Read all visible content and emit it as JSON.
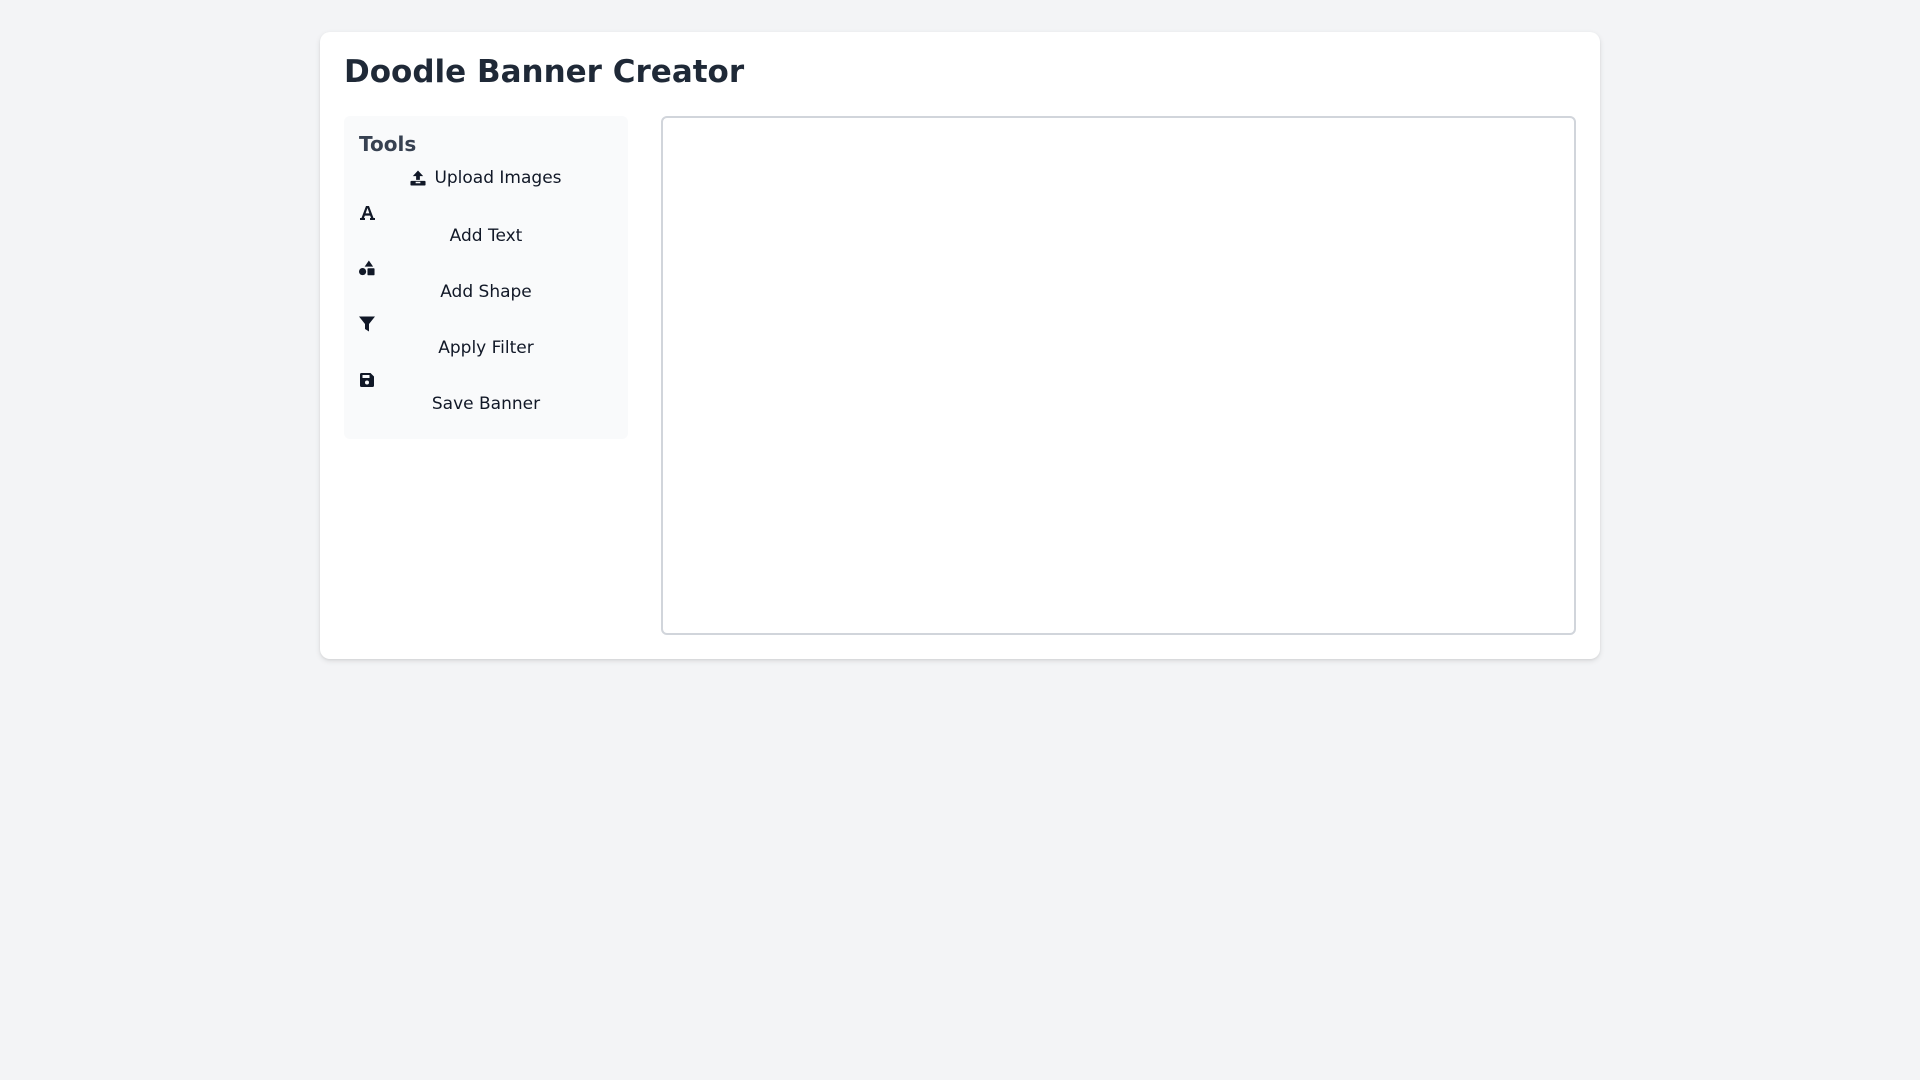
{
  "app": {
    "title": "Doodle Banner Creator"
  },
  "tools": {
    "heading": "Tools",
    "items": [
      {
        "label": "Upload Images",
        "icon": "upload-icon"
      },
      {
        "label": "Add Text",
        "icon": "font-icon"
      },
      {
        "label": "Add Shape",
        "icon": "shapes-icon"
      },
      {
        "label": "Apply Filter",
        "icon": "filter-icon"
      },
      {
        "label": "Save Banner",
        "icon": "save-icon"
      }
    ]
  },
  "colors": {
    "background": "#f3f4f6",
    "card": "#ffffff",
    "panel": "#f9fafb",
    "canvas_border": "#d1d5db",
    "text": "#111827"
  }
}
